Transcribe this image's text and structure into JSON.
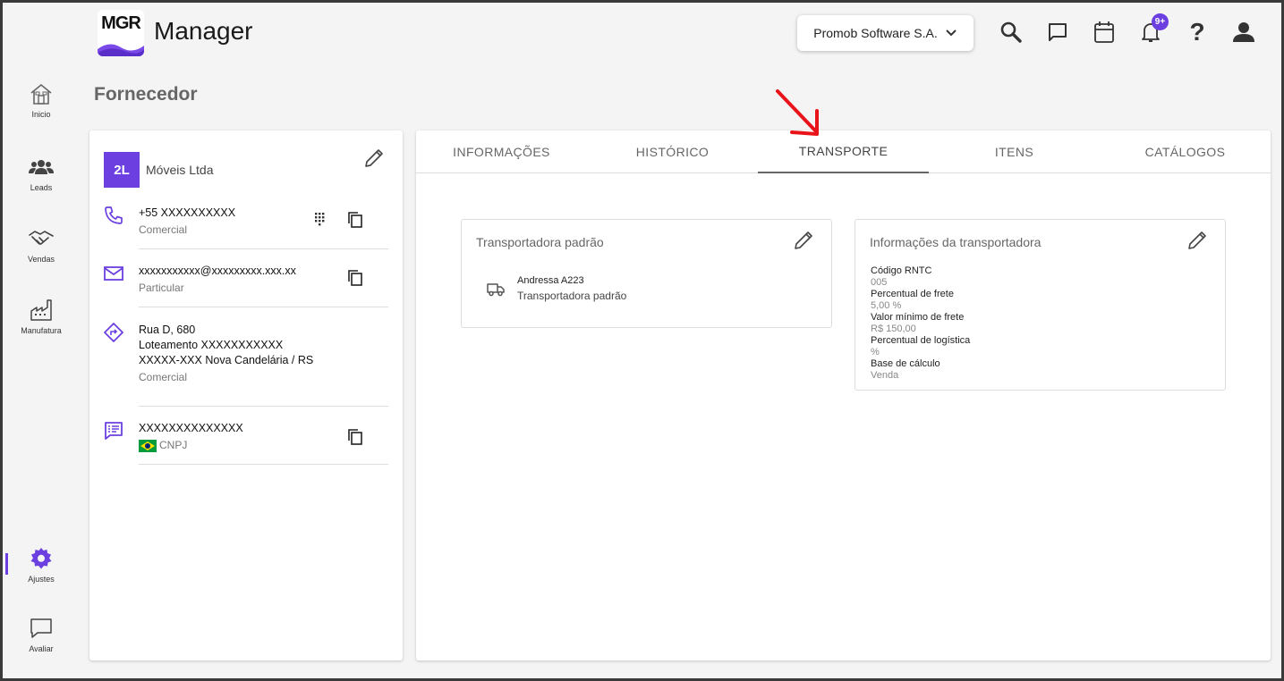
{
  "header": {
    "logo_text": "MGR",
    "app_title": "Manager",
    "company": "Promob Software S.A.",
    "notif_count": "9+",
    "icons": [
      "search-icon",
      "chat-icon",
      "calendar-icon",
      "bell-icon",
      "help-icon",
      "user-icon"
    ]
  },
  "sidebar": {
    "items": [
      {
        "label": "Inicio",
        "icon": "home-icon"
      },
      {
        "label": "Leads",
        "icon": "group-icon"
      },
      {
        "label": "Vendas",
        "icon": "handshake-icon"
      },
      {
        "label": "Manufatura",
        "icon": "factory-icon"
      },
      {
        "label": "Ajustes",
        "icon": "gear-icon"
      },
      {
        "label": "Avaliar",
        "icon": "feedback-icon"
      }
    ],
    "active": "Ajustes"
  },
  "page": {
    "title": "Fornecedor"
  },
  "supplier": {
    "avatar": "2L",
    "name": "Móveis Ltda",
    "phone": {
      "value": "+55 XXXXXXXXXX",
      "type": "Comercial"
    },
    "email": {
      "value": "xxxxxxxxxxx@xxxxxxxxx.xxx.xx",
      "type": "Particular"
    },
    "address": {
      "line1": "Rua D, 680",
      "line2": "Loteamento  XXXXXXXXXXX",
      "line3": "XXXXX-XXX Nova Candelária / RS",
      "type": "Comercial"
    },
    "document": {
      "value": "XXXXXXXXXXXXXX",
      "type": "CNPJ"
    }
  },
  "tabs": [
    {
      "label": "INFORMAÇÕES",
      "active": false
    },
    {
      "label": "HISTÓRICO",
      "active": false
    },
    {
      "label": "TRANSPORTE",
      "active": true
    },
    {
      "label": "ITENS",
      "active": false
    },
    {
      "label": "CATÁLOGOS",
      "active": false
    }
  ],
  "transport": {
    "default_card": {
      "title": "Transportadora padrão",
      "carrier_name": "Andressa A223",
      "carrier_desc": "Transportadora padrão"
    },
    "info_card": {
      "title": "Informações da transportadora",
      "fields": [
        {
          "label": "Código RNTC",
          "value": "005"
        },
        {
          "label": "Percentual de frete",
          "value": "5,00 %"
        },
        {
          "label": "Valor mínimo de frete",
          "value": "R$ 150,00"
        },
        {
          "label": "Percentual de logística",
          "value": "%"
        },
        {
          "label": "Base de cálculo",
          "value": "Venda"
        }
      ]
    }
  },
  "colors": {
    "accent": "#6c3fe0",
    "annotation": "#e8141a"
  }
}
